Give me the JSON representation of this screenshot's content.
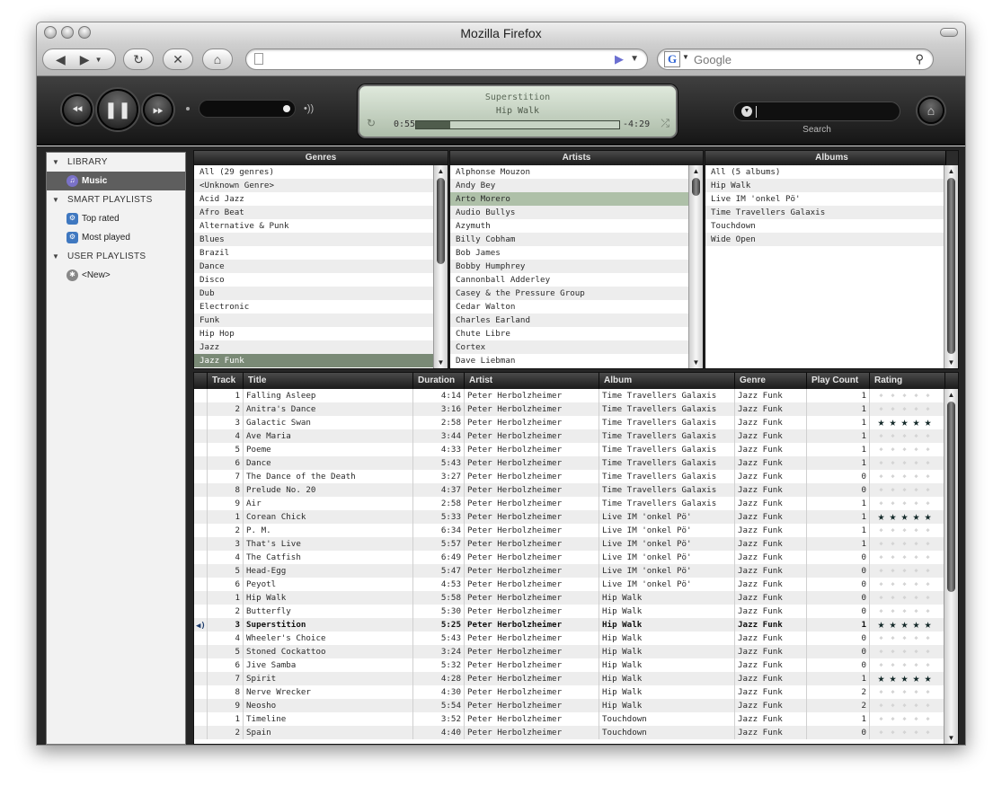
{
  "window": {
    "title": "Mozilla Firefox"
  },
  "browser": {
    "url": "",
    "search_engine_glyph": "G",
    "search_placeholder": "Google"
  },
  "player": {
    "now_playing": {
      "title": "Superstition",
      "album": "Hip Walk"
    },
    "elapsed": "0:55",
    "remaining": "-4:29",
    "progress": 0.17,
    "search_label": "Search",
    "search_value": ""
  },
  "sidebar": {
    "library": {
      "label": "LIBRARY",
      "items": [
        {
          "label": "Music",
          "icon": "music-note-icon",
          "selected": true
        }
      ]
    },
    "smart_playlists": {
      "label": "SMART PLAYLISTS",
      "items": [
        {
          "label": "Top rated",
          "icon": "smart-playlist-icon"
        },
        {
          "label": "Most played",
          "icon": "smart-playlist-icon"
        }
      ]
    },
    "user_playlists": {
      "label": "USER PLAYLISTS",
      "items": [
        {
          "label": "<New>",
          "icon": "new-playlist-icon"
        }
      ]
    }
  },
  "browse": {
    "genres": {
      "header": "Genres",
      "selected_index": 14,
      "items": [
        "All (29 genres)",
        "<Unknown Genre>",
        "Acid Jazz",
        "Afro Beat",
        "Alternative & Punk",
        "Blues",
        "Brazil",
        "Dance",
        "Disco",
        "Dub",
        "Electronic",
        "Funk",
        "Hip Hop",
        "Jazz",
        "Jazz Funk"
      ]
    },
    "artists": {
      "header": "Artists",
      "selected_index": 2,
      "items": [
        "Alphonse Mouzon",
        "Andy Bey",
        "Arto Morero",
        "Audio Bullys",
        "Azymuth",
        "Billy Cobham",
        "Bob James",
        "Bobby Humphrey",
        "Cannonball Adderley",
        "Casey & the Pressure Group",
        "Cedar Walton",
        "Charles Earland",
        "Chute Libre",
        "Cortex",
        "Dave Liebman"
      ]
    },
    "albums": {
      "header": "Albums",
      "items": [
        "All (5 albums)",
        "Hip Walk",
        "Live IM 'onkel Pö'",
        "Time Travellers Galaxis",
        "Touchdown",
        "Wide Open"
      ]
    }
  },
  "tracklist": {
    "columns": {
      "track": "Track",
      "title": "Title",
      "duration": "Duration",
      "artist": "Artist",
      "album": "Album",
      "genre": "Genre",
      "plays": "Play Count",
      "rating": "Rating"
    },
    "playing_index": 17,
    "rows": [
      {
        "track": "1",
        "title": "Falling Asleep",
        "duration": "4:14",
        "artist": "Peter Herbolzheimer",
        "album": "Time Travellers Galaxis",
        "genre": "Jazz Funk",
        "plays": "1",
        "rating": 0
      },
      {
        "track": "2",
        "title": "Anitra's Dance",
        "duration": "3:16",
        "artist": "Peter Herbolzheimer",
        "album": "Time Travellers Galaxis",
        "genre": "Jazz Funk",
        "plays": "1",
        "rating": 0
      },
      {
        "track": "3",
        "title": "Galactic Swan",
        "duration": "2:58",
        "artist": "Peter Herbolzheimer",
        "album": "Time Travellers Galaxis",
        "genre": "Jazz Funk",
        "plays": "1",
        "rating": 5
      },
      {
        "track": "4",
        "title": "Ave Maria",
        "duration": "3:44",
        "artist": "Peter Herbolzheimer",
        "album": "Time Travellers Galaxis",
        "genre": "Jazz Funk",
        "plays": "1",
        "rating": 0
      },
      {
        "track": "5",
        "title": "Poeme",
        "duration": "4:33",
        "artist": "Peter Herbolzheimer",
        "album": "Time Travellers Galaxis",
        "genre": "Jazz Funk",
        "plays": "1",
        "rating": 0
      },
      {
        "track": "6",
        "title": "Dance",
        "duration": "5:43",
        "artist": "Peter Herbolzheimer",
        "album": "Time Travellers Galaxis",
        "genre": "Jazz Funk",
        "plays": "1",
        "rating": 0
      },
      {
        "track": "7",
        "title": "The Dance of the Death",
        "duration": "3:27",
        "artist": "Peter Herbolzheimer",
        "album": "Time Travellers Galaxis",
        "genre": "Jazz Funk",
        "plays": "0",
        "rating": 0
      },
      {
        "track": "8",
        "title": "Prelude No. 20",
        "duration": "4:37",
        "artist": "Peter Herbolzheimer",
        "album": "Time Travellers Galaxis",
        "genre": "Jazz Funk",
        "plays": "0",
        "rating": 0
      },
      {
        "track": "9",
        "title": "Air",
        "duration": "2:58",
        "artist": "Peter Herbolzheimer",
        "album": "Time Travellers Galaxis",
        "genre": "Jazz Funk",
        "plays": "1",
        "rating": 0
      },
      {
        "track": "1",
        "title": "Corean Chick",
        "duration": "5:33",
        "artist": "Peter Herbolzheimer",
        "album": "Live IM 'onkel Pö'",
        "genre": "Jazz Funk",
        "plays": "1",
        "rating": 5
      },
      {
        "track": "2",
        "title": "P. M.",
        "duration": "6:34",
        "artist": "Peter Herbolzheimer",
        "album": "Live IM 'onkel Pö'",
        "genre": "Jazz Funk",
        "plays": "1",
        "rating": 0
      },
      {
        "track": "3",
        "title": "That's Live",
        "duration": "5:57",
        "artist": "Peter Herbolzheimer",
        "album": "Live IM 'onkel Pö'",
        "genre": "Jazz Funk",
        "plays": "1",
        "rating": 0
      },
      {
        "track": "4",
        "title": "The Catfish",
        "duration": "6:49",
        "artist": "Peter Herbolzheimer",
        "album": "Live IM 'onkel Pö'",
        "genre": "Jazz Funk",
        "plays": "0",
        "rating": 0
      },
      {
        "track": "5",
        "title": "Head-Egg",
        "duration": "5:47",
        "artist": "Peter Herbolzheimer",
        "album": "Live IM 'onkel Pö'",
        "genre": "Jazz Funk",
        "plays": "0",
        "rating": 0
      },
      {
        "track": "6",
        "title": "Peyotl",
        "duration": "4:53",
        "artist": "Peter Herbolzheimer",
        "album": "Live IM 'onkel Pö'",
        "genre": "Jazz Funk",
        "plays": "0",
        "rating": 0
      },
      {
        "track": "1",
        "title": "Hip Walk",
        "duration": "5:58",
        "artist": "Peter Herbolzheimer",
        "album": "Hip Walk",
        "genre": "Jazz Funk",
        "plays": "0",
        "rating": 0
      },
      {
        "track": "2",
        "title": "Butterfly",
        "duration": "5:30",
        "artist": "Peter Herbolzheimer",
        "album": "Hip Walk",
        "genre": "Jazz Funk",
        "plays": "0",
        "rating": 0
      },
      {
        "track": "3",
        "title": "Superstition",
        "duration": "5:25",
        "artist": "Peter Herbolzheimer",
        "album": "Hip Walk",
        "genre": "Jazz Funk",
        "plays": "1",
        "rating": 5
      },
      {
        "track": "4",
        "title": "Wheeler's Choice",
        "duration": "5:43",
        "artist": "Peter Herbolzheimer",
        "album": "Hip Walk",
        "genre": "Jazz Funk",
        "plays": "0",
        "rating": 0
      },
      {
        "track": "5",
        "title": "Stoned Cockattoo",
        "duration": "3:24",
        "artist": "Peter Herbolzheimer",
        "album": "Hip Walk",
        "genre": "Jazz Funk",
        "plays": "0",
        "rating": 0
      },
      {
        "track": "6",
        "title": "Jive Samba",
        "duration": "5:32",
        "artist": "Peter Herbolzheimer",
        "album": "Hip Walk",
        "genre": "Jazz Funk",
        "plays": "0",
        "rating": 0
      },
      {
        "track": "7",
        "title": "Spirit",
        "duration": "4:28",
        "artist": "Peter Herbolzheimer",
        "album": "Hip Walk",
        "genre": "Jazz Funk",
        "plays": "1",
        "rating": 5
      },
      {
        "track": "8",
        "title": "Nerve Wrecker",
        "duration": "4:30",
        "artist": "Peter Herbolzheimer",
        "album": "Hip Walk",
        "genre": "Jazz Funk",
        "plays": "2",
        "rating": 0
      },
      {
        "track": "9",
        "title": "Neosho",
        "duration": "5:54",
        "artist": "Peter Herbolzheimer",
        "album": "Hip Walk",
        "genre": "Jazz Funk",
        "plays": "2",
        "rating": 0
      },
      {
        "track": "1",
        "title": "Timeline",
        "duration": "3:52",
        "artist": "Peter Herbolzheimer",
        "album": "Touchdown",
        "genre": "Jazz Funk",
        "plays": "1",
        "rating": 0
      },
      {
        "track": "2",
        "title": "Spain",
        "duration": "4:40",
        "artist": "Peter Herbolzheimer",
        "album": "Touchdown",
        "genre": "Jazz Funk",
        "plays": "0",
        "rating": 0
      }
    ]
  }
}
